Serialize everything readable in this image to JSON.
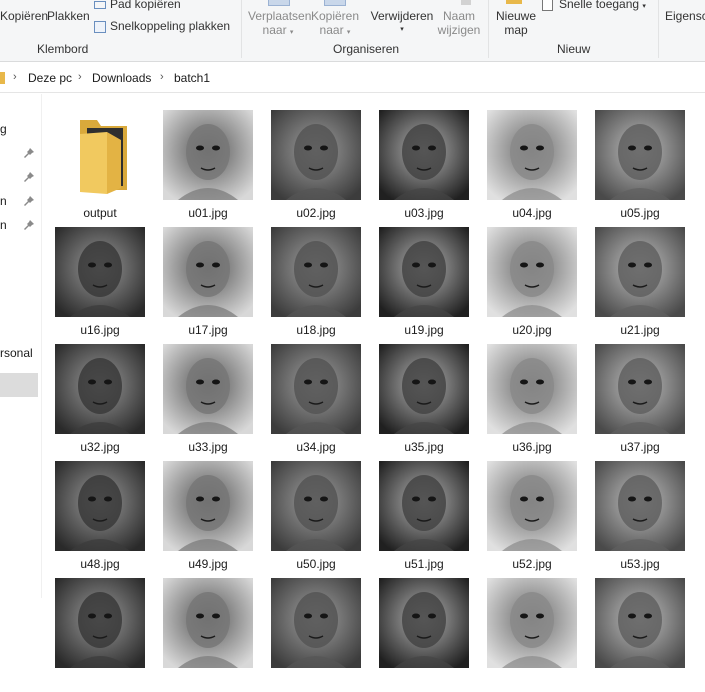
{
  "ribbon": {
    "kopieren": "Kopiëren",
    "plakken": "Plakken",
    "pad_kopieren": "Pad kopiëren",
    "snelkoppeling": "Snelkoppeling plakken",
    "klembord": "Klembord",
    "verplaatsen_1": "Verplaatsen",
    "verplaatsen_2": "naar",
    "kopieren_naar_1": "Kopiëren",
    "kopieren_naar_2": "naar",
    "verwijderen": "Verwijderen",
    "naam_1": "Naam",
    "naam_2": "wijzigen",
    "organiseren": "Organiseren",
    "nieuwe_1": "Nieuwe",
    "nieuwe_2": "map",
    "snelle_toegang": "Snelle toegang",
    "nieuw": "Nieuw",
    "eigenschappen": "Eigensc"
  },
  "address": {
    "crumbs": [
      "Deze pc",
      "Downloads",
      "batch1"
    ]
  },
  "nav": {
    "items": [
      "g",
      "",
      "",
      "n",
      "n",
      "rsonal"
    ]
  },
  "files": [
    {
      "name": "output",
      "type": "folder"
    },
    {
      "name": "u01.jpg",
      "type": "image"
    },
    {
      "name": "u02.jpg",
      "type": "image"
    },
    {
      "name": "u03.jpg",
      "type": "image"
    },
    {
      "name": "u04.jpg",
      "type": "image"
    },
    {
      "name": "u05.jpg",
      "type": "image"
    },
    {
      "name": "u16.jpg",
      "type": "image"
    },
    {
      "name": "u17.jpg",
      "type": "image"
    },
    {
      "name": "u18.jpg",
      "type": "image"
    },
    {
      "name": "u19.jpg",
      "type": "image"
    },
    {
      "name": "u20.jpg",
      "type": "image"
    },
    {
      "name": "u21.jpg",
      "type": "image"
    },
    {
      "name": "u32.jpg",
      "type": "image"
    },
    {
      "name": "u33.jpg",
      "type": "image"
    },
    {
      "name": "u34.jpg",
      "type": "image"
    },
    {
      "name": "u35.jpg",
      "type": "image"
    },
    {
      "name": "u36.jpg",
      "type": "image"
    },
    {
      "name": "u37.jpg",
      "type": "image"
    },
    {
      "name": "u48.jpg",
      "type": "image"
    },
    {
      "name": "u49.jpg",
      "type": "image"
    },
    {
      "name": "u50.jpg",
      "type": "image"
    },
    {
      "name": "u51.jpg",
      "type": "image"
    },
    {
      "name": "u52.jpg",
      "type": "image"
    },
    {
      "name": "u53.jpg",
      "type": "image"
    },
    {
      "name": "",
      "type": "image"
    },
    {
      "name": "",
      "type": "image"
    },
    {
      "name": "",
      "type": "image"
    },
    {
      "name": "",
      "type": "image"
    },
    {
      "name": "",
      "type": "image"
    },
    {
      "name": "",
      "type": "image"
    }
  ],
  "colors": {
    "accent": "#0078d7",
    "folder": "#e8b84a",
    "selection": "#dcdcdc"
  }
}
